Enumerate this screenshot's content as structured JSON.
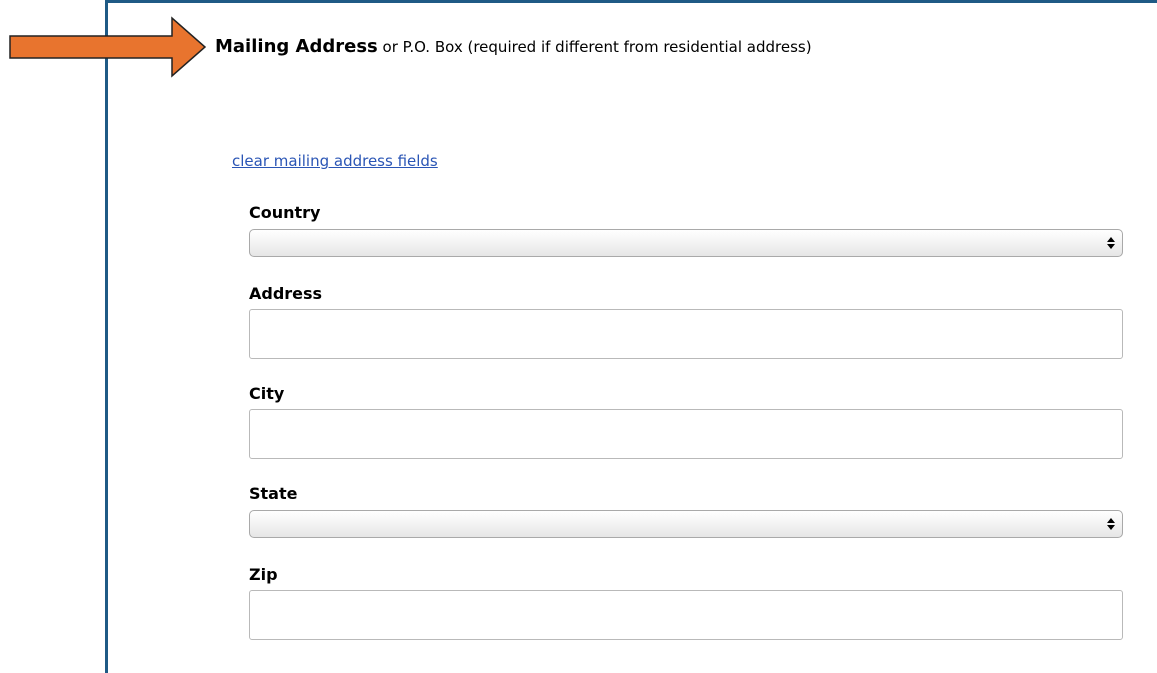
{
  "section": {
    "title_bold": "Mailing Address",
    "title_rest": " or P.O. Box (required if different from residential address)"
  },
  "clear_link": "clear mailing address fields",
  "fields": {
    "country": {
      "label": "Country",
      "value": ""
    },
    "address": {
      "label": "Address",
      "value": "",
      "placeholder": ""
    },
    "city": {
      "label": "City",
      "value": "",
      "placeholder": ""
    },
    "state": {
      "label": "State",
      "value": ""
    },
    "zip": {
      "label": "Zip",
      "value": "",
      "placeholder": ""
    }
  },
  "colors": {
    "arrow": "#e8742e",
    "border": "#1f5a85",
    "link": "#2a55b5"
  },
  "icons": {
    "arrow": "right-arrow-icon",
    "select_toggle": "updown-chevron-icon"
  }
}
